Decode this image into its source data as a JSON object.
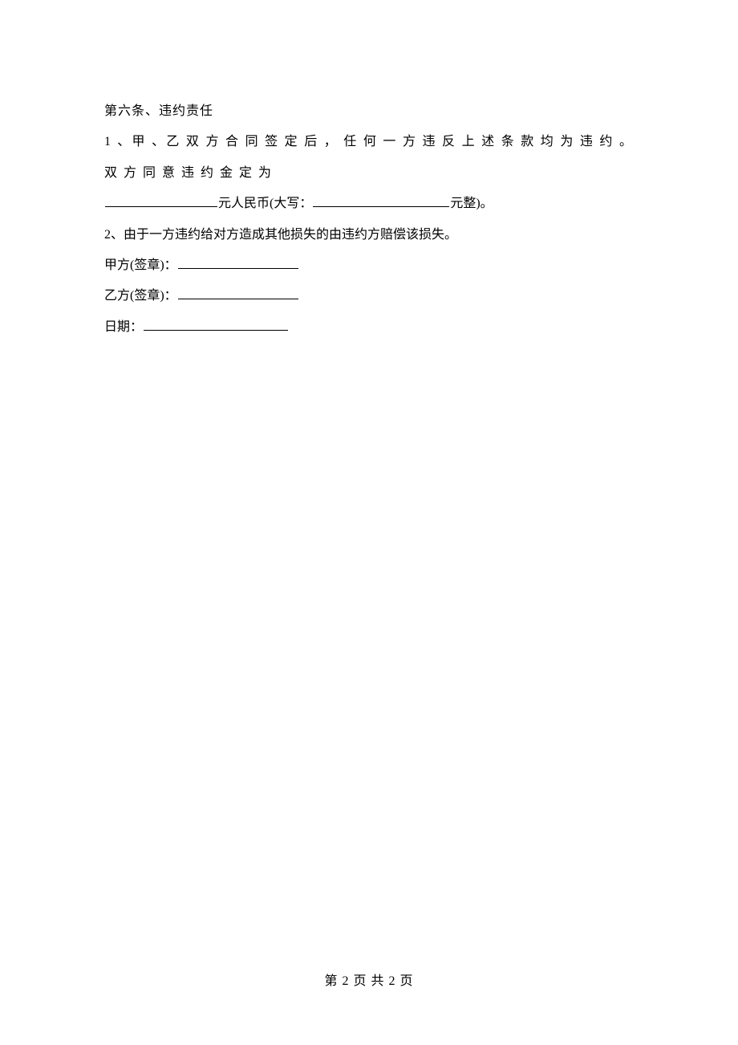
{
  "article": {
    "heading": "第六条、违约责任",
    "item1_part1": "1 、甲 、乙 双 方 合 同 签 定 后 ， 任 何 一 方 违 反 上 述 条 款 均 为 违 约 。 双 方 同 意 违 约 金 定 为",
    "item1_mid1": "元人民币(大写：",
    "item1_mid2": "元整)。",
    "item2": "2、由于一方违约给对方造成其他损失的由违约方赔偿该损失。"
  },
  "signatures": {
    "party_a": "甲方(签章)：",
    "party_b": "乙方(签章)：",
    "date": "日期："
  },
  "footer": {
    "page_indicator": "第 2 页 共 2 页"
  }
}
